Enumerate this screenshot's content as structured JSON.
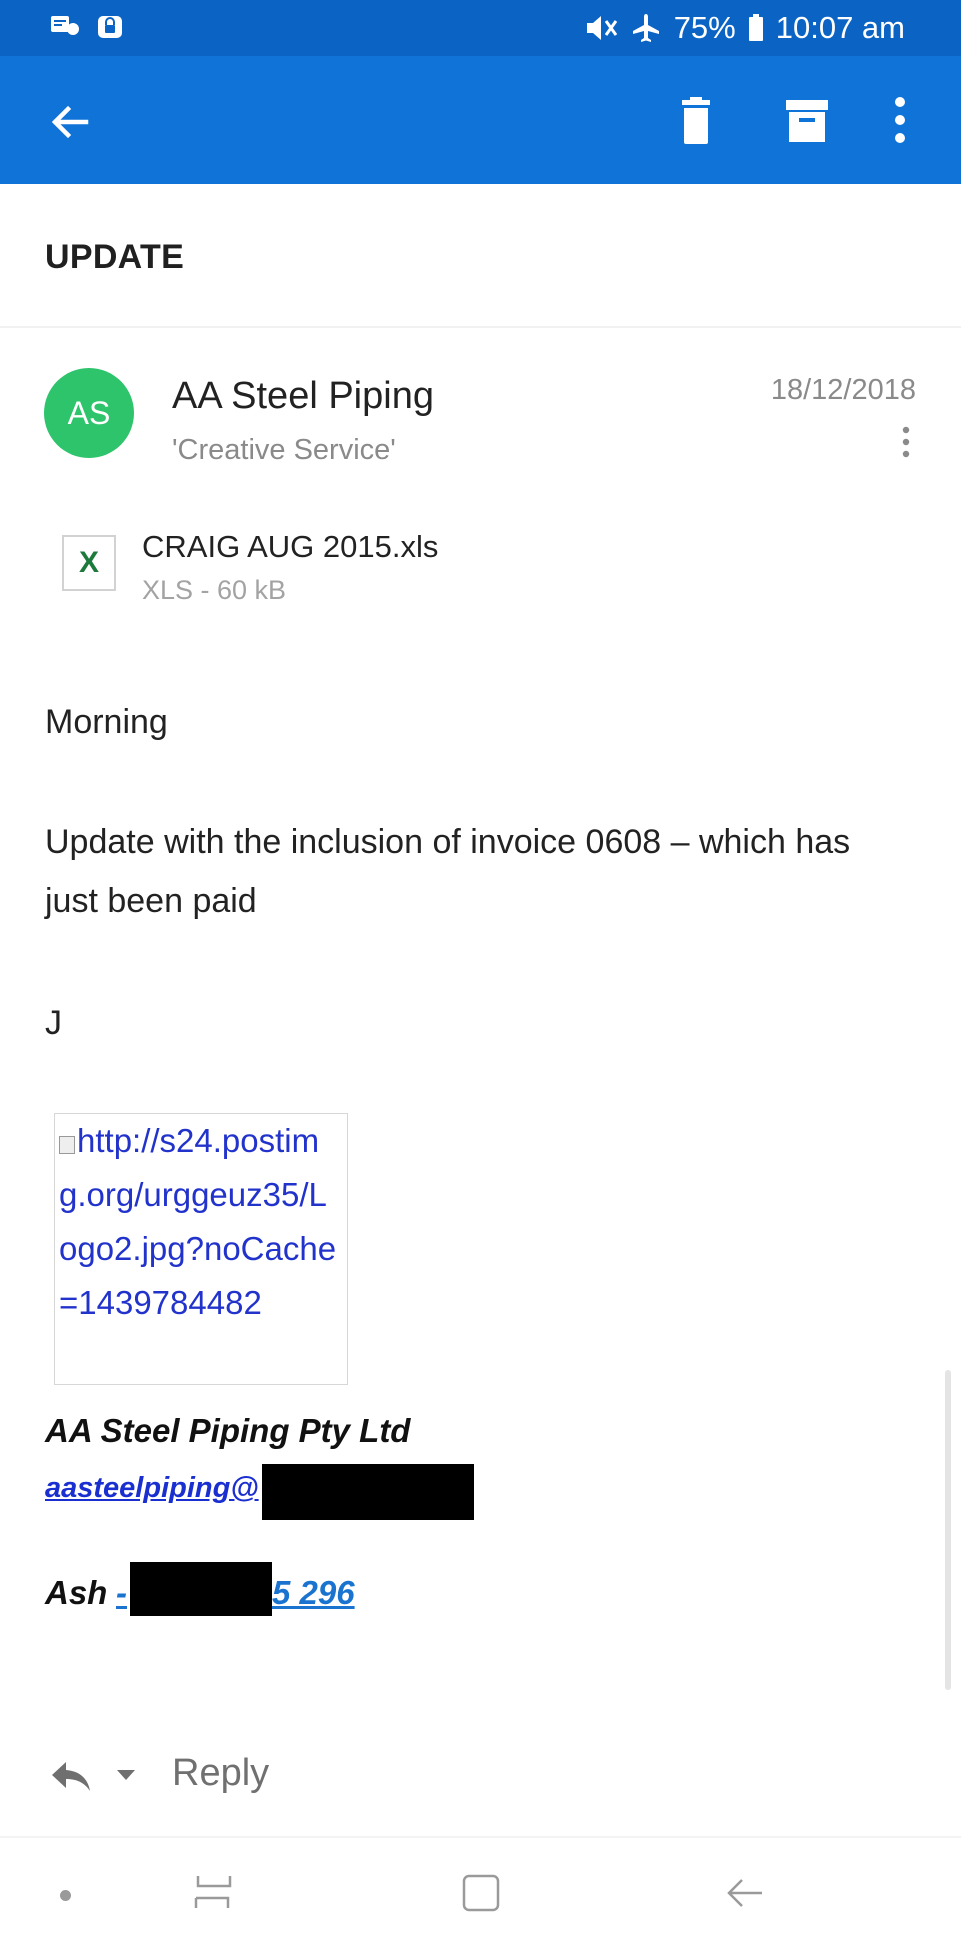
{
  "status_bar": {
    "battery": "75%",
    "time": "10:07 am"
  },
  "app_bar": {
    "back_icon": "arrow-left-icon",
    "delete_icon": "trash-icon",
    "archive_icon": "archive-icon",
    "more_icon": "more-vert-icon"
  },
  "message": {
    "subject": "UPDATE",
    "sender": {
      "initials": "AS",
      "name": "AA Steel Piping",
      "recipient": "'Creative Service'",
      "date": "18/12/2018",
      "avatar_color": "#2ec46b"
    },
    "attachment": {
      "icon_letter": "X",
      "name": "CRAIG AUG 2015.xls",
      "meta": "XLS - 60 kB"
    },
    "body": {
      "greeting": "Morning",
      "paragraph": "Update with the inclusion of invoice 0608 – which has just been paid",
      "initial": "J"
    },
    "signature": {
      "image_alt": "http://s24.postimg.org/urggeuz35/Logo2.jpg?noCache=1439784482",
      "company": "AA Steel Piping Pty Ltd",
      "email_visible": "aasteelpiping@",
      "name": "Ash",
      "phone_prefix": "-",
      "phone_suffix": "5 296"
    }
  },
  "reply_bar": {
    "label": "Reply"
  },
  "colors": {
    "status_bar": "#0b63c4",
    "app_bar": "#0f73d8",
    "link": "#1a2fd0",
    "phone_link": "#1a74cf"
  }
}
